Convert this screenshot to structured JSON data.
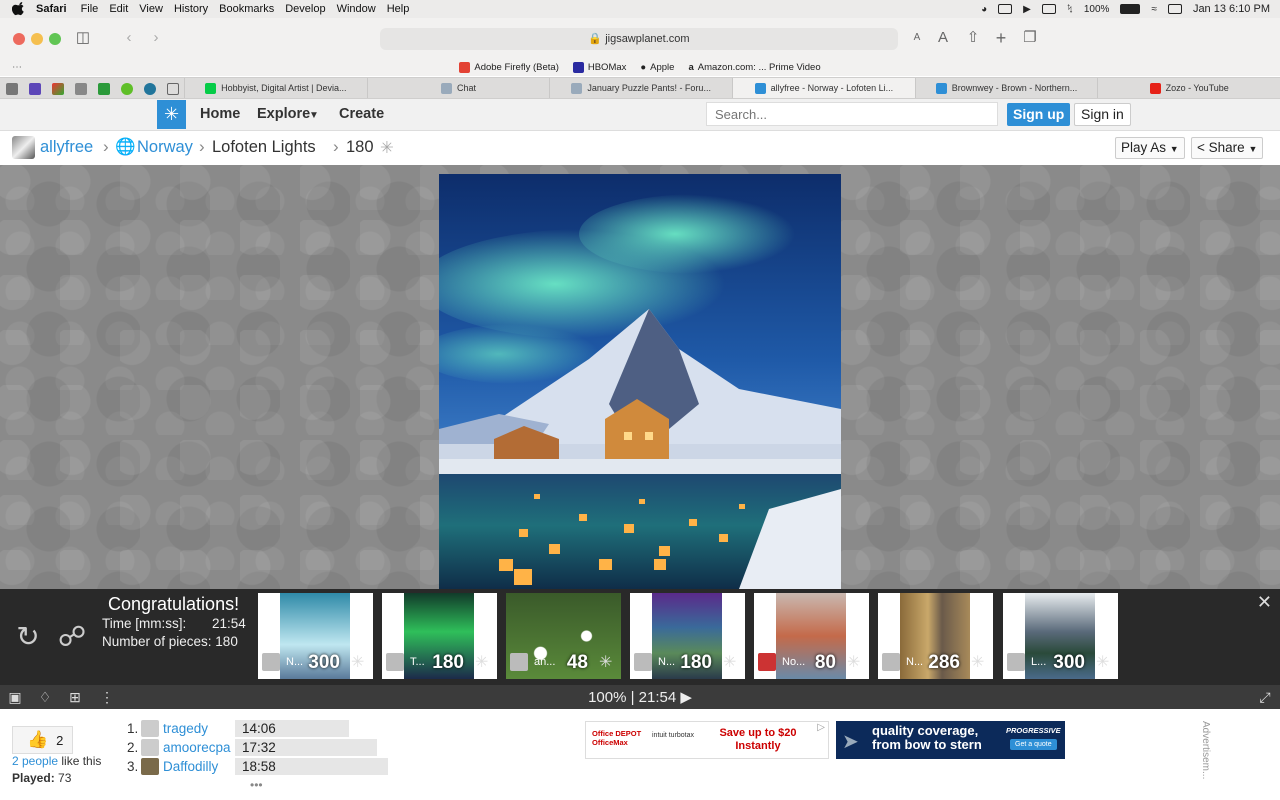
{
  "menubar": {
    "items": [
      "Safari",
      "File",
      "Edit",
      "View",
      "History",
      "Bookmarks",
      "Develop",
      "Window",
      "Help"
    ],
    "battery": "100%",
    "datetime": "Jan 13  6:10 PM"
  },
  "browser": {
    "url": "jigsawplanet.com",
    "favorites": [
      "Adobe Firefly (Beta)",
      "HBOMax",
      "Apple",
      "Amazon.com: ... Prime Video"
    ],
    "tabs": [
      "Hobbyist, Digital Artist | Devia...",
      "Chat",
      "January Puzzle Pants! - Foru...",
      "allyfree - Norway - Lofoten Li...",
      "Brownwey - Brown - Northern...",
      "Zozo - YouTube"
    ]
  },
  "site": {
    "nav": [
      "Home",
      "Explore",
      "Create"
    ],
    "search_placeholder": "Search...",
    "signup": "Sign up",
    "signin": "Sign in"
  },
  "breadcrumb": {
    "user": "allyfree",
    "category": "Norway",
    "title": "Lofoten Lights",
    "pieces": "180",
    "play_as": "Play As",
    "share": "Share"
  },
  "done": {
    "congrats": "Congratulations!",
    "time_label": "Time [mm:ss]:",
    "time_value": "21:54",
    "pieces_label": "Number of pieces: 180"
  },
  "suggestions": [
    {
      "name": "N...",
      "count": "300"
    },
    {
      "name": "T...",
      "count": "180"
    },
    {
      "name": "an...",
      "count": "48"
    },
    {
      "name": "N...",
      "count": "180"
    },
    {
      "name": "No...",
      "count": "80"
    },
    {
      "name": "N...",
      "count": "286"
    },
    {
      "name": "L...",
      "count": "300"
    }
  ],
  "controls": {
    "zoom_time": "100%  |  21:54 ▶"
  },
  "stats": {
    "likes_count": "2",
    "likes_link": "2 people",
    "likes_text": " like this",
    "played_label": "Played:",
    "played_value": " 73"
  },
  "leaderboard": [
    {
      "rank": "1.",
      "user": "tragedy",
      "time": "14:06"
    },
    {
      "rank": "2.",
      "user": "amoorecpa",
      "time": "17:32"
    },
    {
      "rank": "3.",
      "user": "Daffodilly",
      "time": "18:58"
    }
  ],
  "more": "•••",
  "ads": {
    "ad1_brand": "Office DEPOT OfficeMax",
    "ad1_partner": "intuit turbotax",
    "ad1_text": "Save up to $20 Instantly",
    "ad2_text": "quality coverage, from bow to stern",
    "ad2_brand": "PROGRESSIVE",
    "ad2_cta": "Get a quote",
    "label": "Advertisem..."
  }
}
